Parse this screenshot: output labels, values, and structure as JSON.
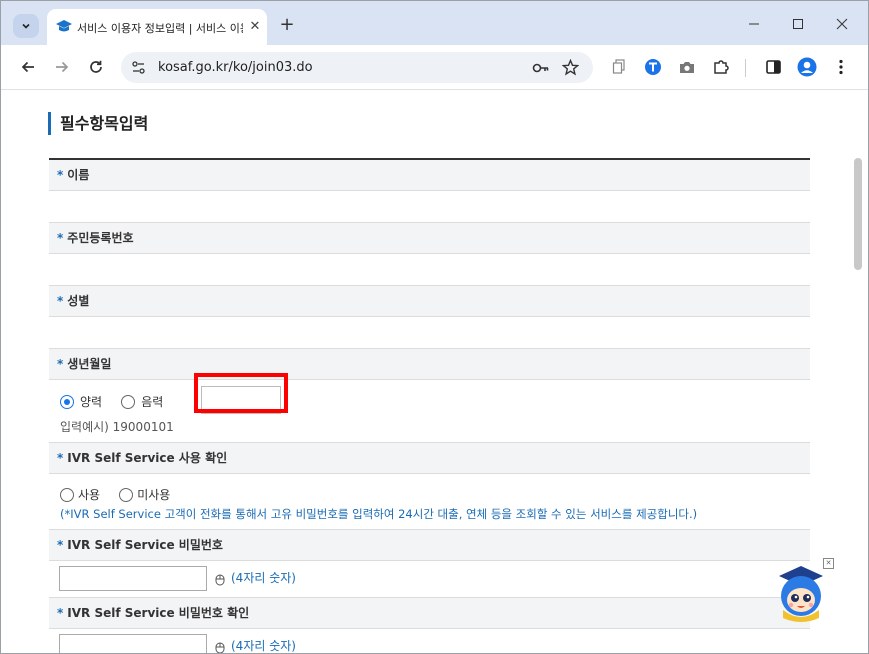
{
  "browser": {
    "tab_title": "서비스 이용자 정보입력 | 서비스 이용",
    "url": "kosaf.go.kr/ko/join03.do",
    "colors": {
      "tabstrip": "#dae3f4",
      "accent": "#1a73e8"
    }
  },
  "page": {
    "section_title": "필수항목입력",
    "fields": {
      "name_label": "이름",
      "rrn_label": "주민등록번호",
      "gender_label": "성별",
      "birth_label": "생년월일",
      "birth_solar": "양력",
      "birth_lunar": "음력",
      "birth_selected": "양력",
      "birth_example": "입력예시) 19000101",
      "birth_value": "",
      "ivr_use_label": "IVR Self Service 사용 확인",
      "ivr_use_yes": "사용",
      "ivr_use_no": "미사용",
      "ivr_use_note": "(*IVR Self Service 고객이 전화를 통해서 고유 비밀번호를 입력하여 24시간 대출, 연체 등을 조회할 수 있는 서비스를 제공합니다.)",
      "ivr_pw_label": "IVR Self Service 비밀번호",
      "ivr_pw_hint": "(4자리 숫자)",
      "ivr_pw_confirm_label": "IVR Self Service 비밀번호 확인",
      "ivr_pw_confirm_hint": "(4자리 숫자)"
    },
    "required_mark": "*",
    "colors": {
      "label_bg": "#f3f4f6",
      "required_star": "#1a6bb5",
      "highlight": "#ff0000"
    }
  }
}
